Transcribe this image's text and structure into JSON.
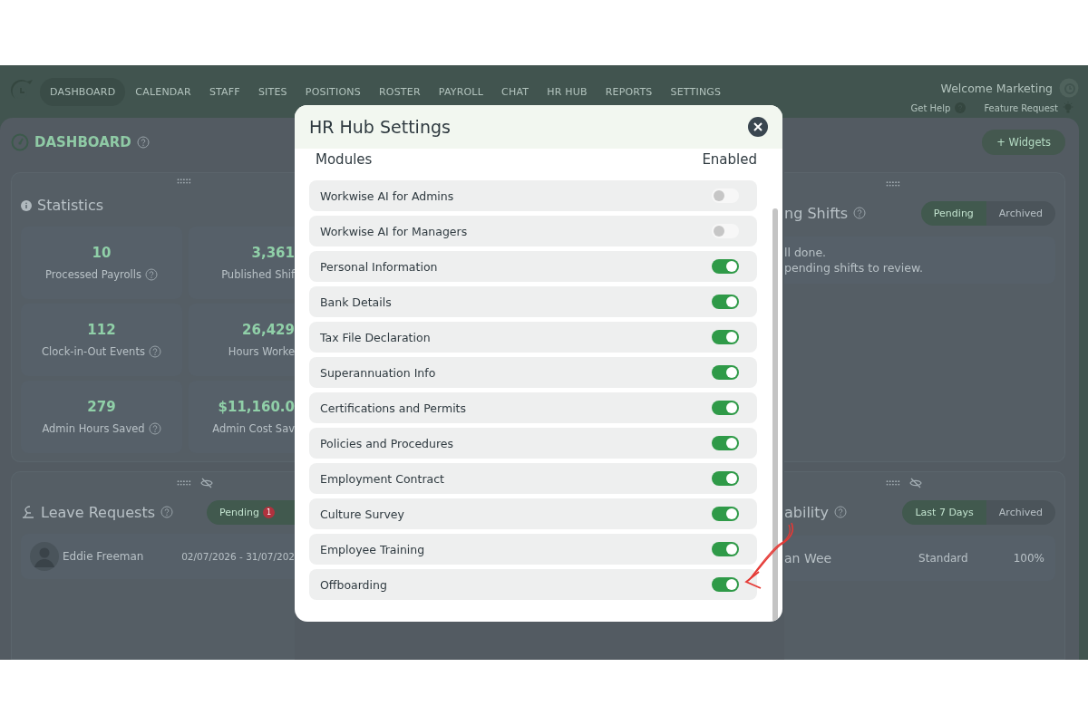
{
  "nav": {
    "items": [
      {
        "label": "DASHBOARD",
        "selected": true
      },
      {
        "label": "CALENDAR",
        "selected": false
      },
      {
        "label": "STAFF",
        "selected": false
      },
      {
        "label": "SITES",
        "selected": false
      },
      {
        "label": "POSITIONS",
        "selected": false
      },
      {
        "label": "ROSTER",
        "selected": false
      },
      {
        "label": "PAYROLL",
        "selected": false
      },
      {
        "label": "CHAT",
        "selected": false
      },
      {
        "label": "HR HUB",
        "selected": false
      },
      {
        "label": "REPORTS",
        "selected": false
      },
      {
        "label": "SETTINGS",
        "selected": false
      }
    ],
    "welcome": "Welcome Marketing",
    "help_link": "Get Help",
    "feature_link": "Feature Request"
  },
  "page": {
    "title": "DASHBOARD",
    "widgets_button": "+ Widgets"
  },
  "statistics": {
    "title": "Statistics",
    "stats": [
      {
        "value": "10",
        "label": "Processed Payrolls",
        "help": true
      },
      {
        "value": "3,361",
        "label": "Published Shif",
        "help": false
      },
      {
        "value": "112",
        "label": "Clock-in-Out Events",
        "help": true
      },
      {
        "value": "26,429",
        "label": "Hours Worke",
        "help": false
      },
      {
        "value": "279",
        "label": "Admin Hours Saved",
        "help": true
      },
      {
        "value": "$11,160.0",
        "label": "Admin Cost Sav",
        "help": false
      }
    ]
  },
  "leave_requests": {
    "title": "Leave Requests",
    "tabs": [
      {
        "label": "Pending",
        "badge": "1",
        "selected": true
      }
    ],
    "rows": [
      {
        "name": "Eddie Freeman",
        "dates": "02/07/2026 - 31/07/202"
      }
    ]
  },
  "shifts_widget": {
    "title": "ng Shifts",
    "tabs": [
      {
        "label": "Pending",
        "selected": true
      },
      {
        "label": "Archived",
        "selected": false
      }
    ],
    "message_lines": [
      "ll done.",
      "pending shifts to review."
    ]
  },
  "widget_4": {
    "title": "ability",
    "tabs": [
      {
        "label": "Last 7 Days",
        "selected": true
      },
      {
        "label": "Archived",
        "selected": false
      }
    ],
    "rows": [
      {
        "column_1": "an Wee",
        "column_2": "Standard",
        "column_3": "100%"
      }
    ]
  },
  "modal": {
    "title": "HR Hub Settings",
    "column_left": "Modules",
    "column_right": "Enabled",
    "modules": [
      {
        "name": "Workwise AI for Admins",
        "on": false
      },
      {
        "name": "Workwise AI for Managers",
        "on": false
      },
      {
        "name": "Personal Information",
        "on": true
      },
      {
        "name": "Bank Details",
        "on": true
      },
      {
        "name": "Tax File Declaration",
        "on": true
      },
      {
        "name": "Superannuation Info",
        "on": true
      },
      {
        "name": "Certifications and Permits",
        "on": true
      },
      {
        "name": "Policies and Procedures",
        "on": true
      },
      {
        "name": "Employment Contract",
        "on": true
      },
      {
        "name": "Culture Survey",
        "on": true
      },
      {
        "name": "Employee Training",
        "on": true
      },
      {
        "name": "Offboarding",
        "on": true
      }
    ]
  }
}
